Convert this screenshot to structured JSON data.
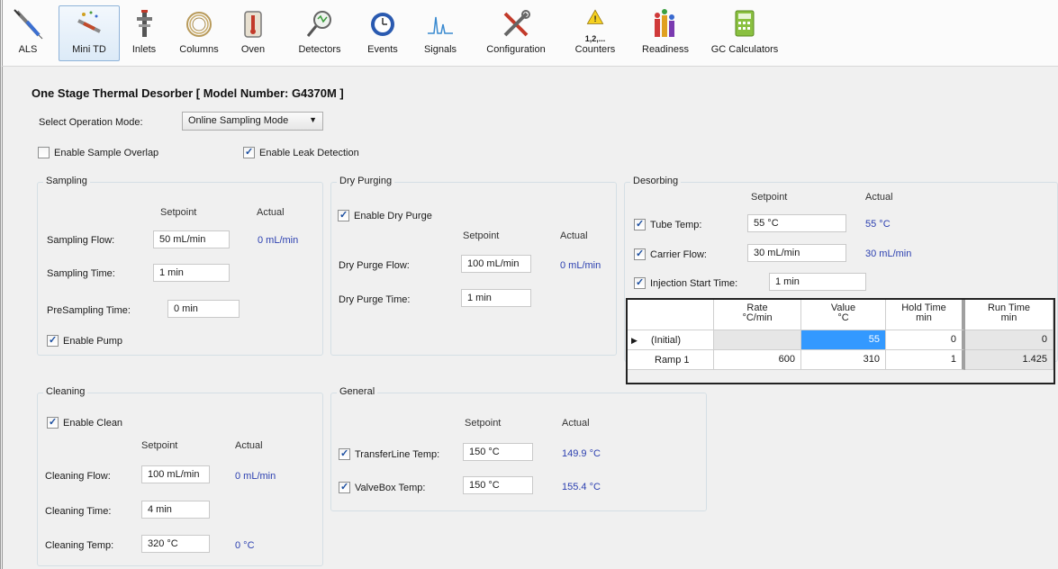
{
  "toolbar": {
    "items": [
      {
        "label": "ALS",
        "icon": "syringe-icon"
      },
      {
        "label": "Mini TD",
        "icon": "thermal-desorber-icon",
        "active": true
      },
      {
        "label": "Inlets",
        "icon": "inlet-icon"
      },
      {
        "label": "Columns",
        "icon": "column-coil-icon"
      },
      {
        "label": "Oven",
        "icon": "oven-icon"
      },
      {
        "label": "Detectors",
        "icon": "detector-icon"
      },
      {
        "label": "Events",
        "icon": "events-clock-icon"
      },
      {
        "label": "Signals",
        "icon": "signal-peaks-icon"
      },
      {
        "label": "Configuration",
        "icon": "tools-icon"
      },
      {
        "label": "Counters",
        "icon": "warning-counter-icon",
        "sublabel": "1,2,..."
      },
      {
        "label": "Readiness",
        "icon": "readiness-bars-icon"
      },
      {
        "label": "GC Calculators",
        "icon": "calculator-icon"
      }
    ]
  },
  "page": {
    "title": "One Stage Thermal Desorber [ Model Number: G4370M ]",
    "mode_label": "Select Operation Mode:",
    "mode_value": "Online Sampling Mode",
    "sample_overlap_label": "Enable Sample Overlap",
    "sample_overlap_checked": false,
    "leak_detection_label": "Enable Leak Detection",
    "leak_detection_checked": true
  },
  "sampling": {
    "title": "Sampling",
    "setpoint_hdr": "Setpoint",
    "actual_hdr": "Actual",
    "flow_label": "Sampling Flow:",
    "flow_setpoint": "50 mL/min",
    "flow_actual": "0 mL/min",
    "time_label": "Sampling Time:",
    "time_setpoint": "1 min",
    "presampling_label": "PreSampling Time:",
    "presampling_setpoint": "0 min",
    "pump_label": "Enable Pump",
    "pump_checked": true
  },
  "dry_purging": {
    "title": "Dry Purging",
    "enable_label": "Enable Dry Purge",
    "enable_checked": true,
    "setpoint_hdr": "Setpoint",
    "actual_hdr": "Actual",
    "flow_label": "Dry Purge Flow:",
    "flow_setpoint": "100 mL/min",
    "flow_actual": "0 mL/min",
    "time_label": "Dry Purge Time:",
    "time_setpoint": "1 min"
  },
  "desorbing": {
    "title": "Desorbing",
    "setpoint_hdr": "Setpoint",
    "actual_hdr": "Actual",
    "tube_label": "Tube Temp:",
    "tube_setpoint": "55 °C",
    "tube_actual": "55 °C",
    "carrier_label": "Carrier Flow:",
    "carrier_setpoint": "30 mL/min",
    "carrier_actual": "30 mL/min",
    "injection_label": "Injection Start Time:",
    "injection_setpoint": "1 min",
    "table": {
      "headers": [
        {
          "line1": "Rate",
          "line2": "°C/min"
        },
        {
          "line1": "Value",
          "line2": "°C"
        },
        {
          "line1": "Hold Time",
          "line2": "min"
        },
        {
          "line1": "Run Time",
          "line2": "min"
        }
      ],
      "rows": [
        {
          "name": "(Initial)",
          "rate": "",
          "value": "55",
          "hold": "0",
          "run": "0"
        },
        {
          "name": "Ramp 1",
          "rate": "600",
          "value": "310",
          "hold": "1",
          "run": "1.425"
        }
      ]
    }
  },
  "cleaning": {
    "title": "Cleaning",
    "enable_label": "Enable Clean",
    "enable_checked": true,
    "setpoint_hdr": "Setpoint",
    "actual_hdr": "Actual",
    "flow_label": "Cleaning Flow:",
    "flow_setpoint": "100 mL/min",
    "flow_actual": "0 mL/min",
    "time_label": "Cleaning Time:",
    "time_setpoint": "4 min",
    "temp_label": "Cleaning Temp:",
    "temp_setpoint": "320 °C",
    "temp_actual": "0 °C"
  },
  "general": {
    "title": "General",
    "setpoint_hdr": "Setpoint",
    "actual_hdr": "Actual",
    "transfer_label": "TransferLine Temp:",
    "transfer_checked": true,
    "transfer_setpoint": "150 °C",
    "transfer_actual": "149.9 °C",
    "valvebox_label": "ValveBox Temp:",
    "valvebox_checked": true,
    "valvebox_setpoint": "150 °C",
    "valvebox_actual": "155.4 °C"
  },
  "colors": {
    "actual_text": "#2b3fb0",
    "selection": "#3399ff",
    "toolbar_active_border": "#8fb3d9"
  }
}
